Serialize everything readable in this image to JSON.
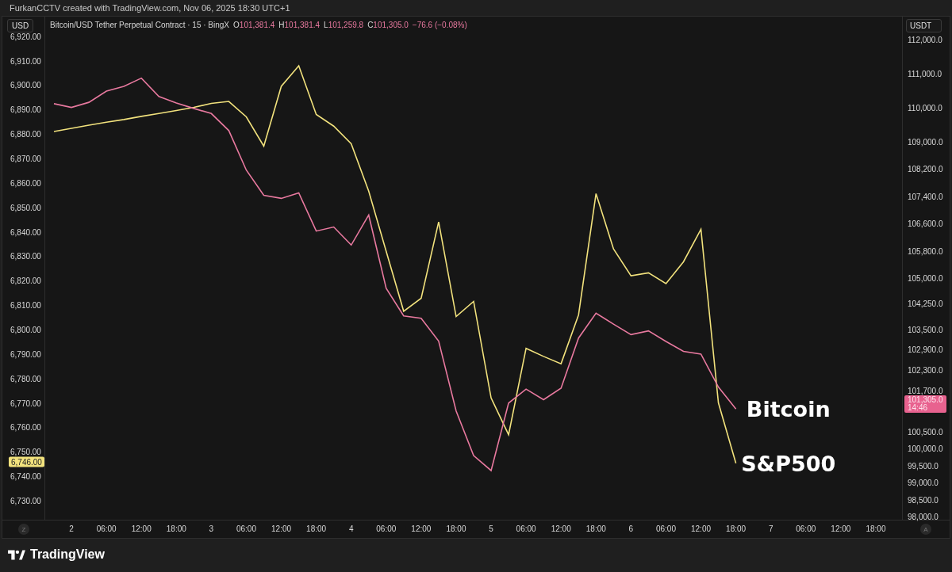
{
  "header": {
    "text": "FurkanCCTV created with TradingView.com, Nov 06, 2025 18:30 UTC+1"
  },
  "left_axis": {
    "currency": "USD",
    "price_tag": "6,746.00"
  },
  "right_axis": {
    "currency": "USDT",
    "price_tag": {
      "label": "101,305.0",
      "timer": "14:46"
    }
  },
  "legend": {
    "symbol": "Bitcoin/USD Tether Perpetual Contract · 15 · BingX",
    "ohlc": [
      {
        "key": "O",
        "value": "101,381.4"
      },
      {
        "key": "H",
        "value": "101,381.4"
      },
      {
        "key": "L",
        "value": "101,259.8"
      },
      {
        "key": "C",
        "value": "101,305.0"
      }
    ],
    "change": "−76.6 (−0.08%)"
  },
  "index_chart": {
    "chart_data": {
      "type": "line",
      "ylim": [
        6722.2,
        6928
      ],
      "categories": [
        null,
        "2",
        null,
        "06:00",
        null,
        "12:00",
        null,
        "18:00",
        null,
        "3",
        null,
        "06:00",
        null,
        "12:00",
        null,
        "18:00",
        null,
        "4",
        null,
        "06:00",
        null,
        "12:00",
        null,
        "18:00",
        null,
        "5",
        null,
        "06:00",
        null,
        "12:00",
        null,
        "18:00",
        null,
        "6",
        null,
        "06:00",
        null,
        "12:00",
        null,
        "18:00",
        null,
        "7",
        null,
        "06:00",
        null,
        "12:00",
        null,
        "18:00",
        null
      ],
      "yticks": [
        {
          "value": 6920,
          "label": "6,920.00"
        },
        {
          "value": 6910,
          "label": "6,910.00"
        },
        {
          "value": 6900,
          "label": "6,900.00"
        },
        {
          "value": 6890,
          "label": "6,890.00"
        },
        {
          "value": 6880,
          "label": "6,880.00"
        },
        {
          "value": 6870,
          "label": "6,870.00"
        },
        {
          "value": 6860,
          "label": "6,860.00"
        },
        {
          "value": 6850,
          "label": "6,850.00"
        },
        {
          "value": 6840,
          "label": "6,840.00"
        },
        {
          "value": 6830,
          "label": "6,830.00"
        },
        {
          "value": 6820,
          "label": "6,820.00"
        },
        {
          "value": 6810,
          "label": "6,810.00"
        },
        {
          "value": 6800,
          "label": "6,800.00"
        },
        {
          "value": 6790,
          "label": "6,790.00"
        },
        {
          "value": 6780,
          "label": "6,780.00"
        },
        {
          "value": 6770,
          "label": "6,770.00"
        },
        {
          "value": 6760,
          "label": "6,760.00"
        },
        {
          "value": 6750,
          "label": "6,750.00"
        },
        {
          "value": 6740,
          "label": "6,740.00"
        },
        {
          "value": 6730,
          "label": "6,730.00"
        }
      ],
      "series": [
        {
          "name": "S&P500",
          "color": "#f2e27d",
          "values": [
            6881,
            6882.3,
            6883.6,
            6884.8,
            6885.9,
            6887.2,
            6888.4,
            6889.6,
            6890.9,
            6892.5,
            6893.3,
            6887,
            6875,
            6899.5,
            6907.9,
            6888,
            6883.2,
            6876,
            6856.6,
            6832,
            6807.5,
            6812.8,
            6844,
            6805.3,
            6811.5,
            6772,
            6757,
            6792.3,
            6789,
            6786,
            6806,
            6855.6,
            6833,
            6822,
            6823.2,
            6818.8,
            6827.7,
            6841,
            6770,
            6745.3,
            null,
            null,
            null,
            null,
            null,
            null,
            null,
            null,
            null
          ]
        }
      ]
    }
  },
  "price_chart": {
    "chart_data": {
      "type": "line",
      "ylim": [
        97907,
        112675
      ],
      "categories": [
        null,
        null,
        null,
        null,
        null,
        null,
        null,
        null,
        null,
        null,
        null,
        null,
        null,
        null,
        null,
        null,
        null,
        null,
        null,
        null,
        null,
        null,
        null,
        null,
        null,
        null,
        null,
        null,
        null,
        null,
        null,
        null,
        null,
        null,
        null,
        null,
        null,
        null,
        null,
        null,
        null,
        null,
        null,
        null,
        null,
        null,
        null,
        null,
        null
      ],
      "yticks": [
        {
          "value": 112000,
          "label": "112,000.0"
        },
        {
          "value": 111000,
          "label": "111,000.0"
        },
        {
          "value": 110000,
          "label": "110,000.0"
        },
        {
          "value": 109000,
          "label": "109,000.0"
        },
        {
          "value": 108200,
          "label": "108,200.0"
        },
        {
          "value": 107400,
          "label": "107,400.0"
        },
        {
          "value": 106600,
          "label": "106,600.0"
        },
        {
          "value": 105800,
          "label": "105,800.0"
        },
        {
          "value": 105000,
          "label": "105,000.0"
        },
        {
          "value": 104250,
          "label": "104,250.0"
        },
        {
          "value": 103500,
          "label": "103,500.0"
        },
        {
          "value": 102900,
          "label": "102,900.0"
        },
        {
          "value": 102300,
          "label": "102,300.0"
        },
        {
          "value": 101700,
          "label": "101,700.0"
        },
        {
          "value": 100500,
          "label": "100,500.0"
        },
        {
          "value": 100000,
          "label": "100,000.0"
        },
        {
          "value": 99500,
          "label": "99,500.0"
        },
        {
          "value": 99000,
          "label": "99,000.0"
        },
        {
          "value": 98500,
          "label": "98,500.0"
        },
        {
          "value": 98000,
          "label": "98,000.0"
        }
      ],
      "series": [
        {
          "name": "Bitcoin",
          "color": "#e8799f",
          "values": [
            110120,
            110010,
            110160,
            110490,
            110630,
            110870,
            110330,
            110140,
            109980,
            109830,
            109330,
            108170,
            107430,
            107340,
            107500,
            106380,
            106500,
            105970,
            106850,
            104700,
            103890,
            103820,
            103150,
            101100,
            99790,
            99350,
            101330,
            101740,
            101430,
            101770,
            103240,
            103970,
            103650,
            103340,
            103450,
            103140,
            102850,
            102770,
            101800,
            101160,
            null,
            null,
            null,
            null,
            null,
            null,
            null,
            null,
            null
          ]
        }
      ]
    }
  },
  "time_axis": {
    "left_button": "Z",
    "right_button": "A"
  },
  "footer": {
    "brand": "TradingView"
  }
}
